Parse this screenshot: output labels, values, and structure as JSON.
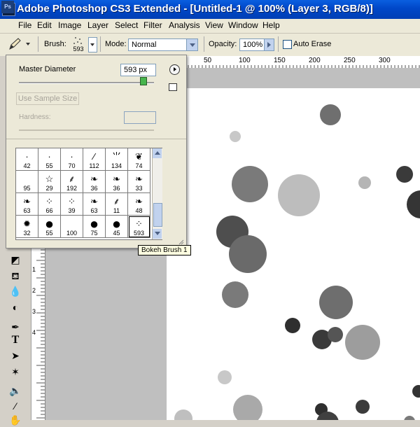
{
  "window": {
    "title": "Adobe Photoshop CS3 Extended - [Untitled-1 @ 100% (Layer 3, RGB/8)]",
    "logo_text": "Ps"
  },
  "menu": [
    "File",
    "Edit",
    "Image",
    "Layer",
    "Select",
    "Filter",
    "Analysis",
    "View",
    "Window",
    "Help"
  ],
  "options": {
    "brush_label": "Brush:",
    "brush_size": "593",
    "mode_label": "Mode:",
    "mode_value": "Normal",
    "opacity_label": "Opacity:",
    "opacity_value": "100%",
    "auto_erase_label": "Auto Erase"
  },
  "brush_panel": {
    "master_diameter_label": "Master Diameter",
    "master_diameter_value": "593 px",
    "use_sample_size_label": "Use Sample Size",
    "hardness_label": "Hardness:",
    "presets": [
      {
        "size": "42",
        "icon": "dot"
      },
      {
        "size": "55",
        "icon": "dot"
      },
      {
        "size": "70",
        "icon": "dot"
      },
      {
        "size": "112",
        "icon": "stroke"
      },
      {
        "size": "134",
        "icon": "grass"
      },
      {
        "size": "74",
        "icon": "leaf"
      },
      {
        "size": "95",
        "icon": "blank"
      },
      {
        "size": "29",
        "icon": "star"
      },
      {
        "size": "192",
        "icon": "leaf-small"
      },
      {
        "size": "36",
        "icon": "butterfly"
      },
      {
        "size": "36",
        "icon": "butterfly"
      },
      {
        "size": "33",
        "icon": "butterfly"
      },
      {
        "size": "63",
        "icon": "butterfly"
      },
      {
        "size": "66",
        "icon": "scatter"
      },
      {
        "size": "39",
        "icon": "scatter"
      },
      {
        "size": "63",
        "icon": "butterfly"
      },
      {
        "size": "11",
        "icon": "leaf-small"
      },
      {
        "size": "48",
        "icon": "butterfly"
      },
      {
        "size": "32",
        "icon": "maple"
      },
      {
        "size": "55",
        "icon": "circle"
      },
      {
        "size": "100",
        "icon": "blank"
      },
      {
        "size": "75",
        "icon": "circle"
      },
      {
        "size": "45",
        "icon": "circle"
      },
      {
        "size": "593",
        "icon": "scatter"
      }
    ],
    "tooltip": "Bokeh Brush 1"
  },
  "ruler": {
    "top_labels": [
      "50",
      "100",
      "150",
      "200",
      "250",
      "300"
    ],
    "left_labels": [
      "1",
      "1",
      "2",
      "2",
      "3",
      "3",
      "4",
      "4"
    ]
  },
  "colors": {
    "titlebar": "#0a5fe0",
    "bokeh_dark": "#3d3d3d",
    "bokeh_mid": "#6f6f6f",
    "bokeh_light": "#bdbdbd"
  }
}
